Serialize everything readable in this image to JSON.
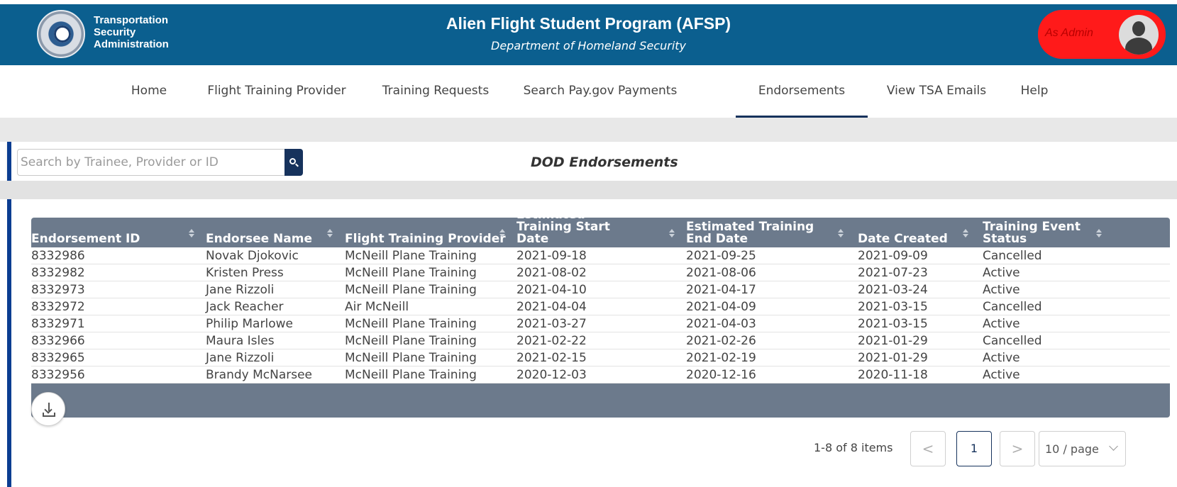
{
  "header": {
    "agency_line1": "Transportation",
    "agency_line2": "Security",
    "agency_line3": "Administration",
    "title": "Alien Flight Student Program (AFSP)",
    "subtitle": "Department of Homeland Security",
    "role": "As Admin",
    "logo_icon": "dhs-seal-icon",
    "avatar_icon": "user-avatar-icon"
  },
  "nav": {
    "items": [
      {
        "label": "Home"
      },
      {
        "label": "Flight Training Provider"
      },
      {
        "label": "Training Requests"
      },
      {
        "label": "Search Pay.gov Payments"
      },
      {
        "label": "Endorsements"
      },
      {
        "label": "View TSA Emails"
      },
      {
        "label": "Help"
      }
    ],
    "active": "Endorsements"
  },
  "search": {
    "placeholder": "Search by Trainee, Provider or ID",
    "icon": "search-icon"
  },
  "panel": {
    "title": "DOD Endorsements"
  },
  "table": {
    "columns": [
      {
        "label": "Endorsement ID"
      },
      {
        "label": "Endorsee Name"
      },
      {
        "label": "Flight Training Provider"
      },
      {
        "label": "Estimated Training Start Date"
      },
      {
        "label": "Estimated Training End Date"
      },
      {
        "label": "Date Created"
      },
      {
        "label": "Training Event Status"
      }
    ],
    "rows": [
      [
        "8332986",
        "Novak Djokovic",
        "McNeill Plane Training",
        "2021-09-18",
        "2021-09-25",
        "2021-09-09",
        "Cancelled"
      ],
      [
        "8332982",
        "Kristen Press",
        "McNeill Plane Training",
        "2021-08-02",
        "2021-08-06",
        "2021-07-23",
        "Active"
      ],
      [
        "8332973",
        "Jane Rizzoli",
        "McNeill Plane Training",
        "2021-04-10",
        "2021-04-17",
        "2021-03-24",
        "Active"
      ],
      [
        "8332972",
        "Jack Reacher",
        "Air McNeill",
        "2021-04-04",
        "2021-04-09",
        "2021-03-15",
        "Cancelled"
      ],
      [
        "8332971",
        "Philip Marlowe",
        "McNeill Plane Training",
        "2021-03-27",
        "2021-04-03",
        "2021-03-15",
        "Active"
      ],
      [
        "8332966",
        "Maura Isles",
        "McNeill Plane Training",
        "2021-02-22",
        "2021-02-26",
        "2021-01-29",
        "Cancelled"
      ],
      [
        "8332965",
        "Jane Rizzoli",
        "McNeill Plane Training",
        "2021-02-15",
        "2021-02-19",
        "2021-01-29",
        "Active"
      ],
      [
        "8332956",
        "Brandy McNarsee",
        "McNeill Plane Training",
        "2020-12-03",
        "2020-12-16",
        "2020-11-18",
        "Active"
      ]
    ],
    "export_icon": "download-icon"
  },
  "pagination": {
    "total_text": "1-8 of 8 items",
    "prev": "<",
    "current_page": "1",
    "next": ">",
    "page_size": "10 / page"
  },
  "colors": {
    "header_bg": "#0b5f8f",
    "user_pill": "#ff1a1a",
    "table_header": "#6c7a8c",
    "accent": "#16325c"
  }
}
